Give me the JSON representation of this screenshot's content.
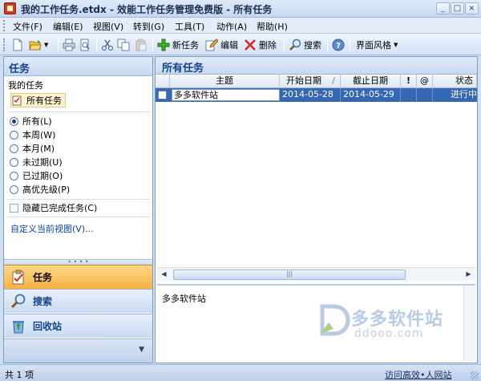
{
  "window": {
    "title": "我的工作任务.etdx - 效能工作任务管理免费版 - 所有任务",
    "buttons": {
      "minimize": "_",
      "maximize": "□",
      "close": "×"
    }
  },
  "menu": [
    "文件(F)",
    "编辑(E)",
    "视图(V)",
    "转到(G)",
    "工具(T)",
    "动作(A)",
    "帮助(H)"
  ],
  "toolbar": {
    "new_task": "新任务",
    "edit": "编辑",
    "delete": "删除",
    "search": "搜索",
    "theme": "界面风格"
  },
  "nav": {
    "header": "任务",
    "section_label": "我的任务",
    "current_view": "所有任务",
    "filters": [
      "所有(L)",
      "本周(W)",
      "本月(M)",
      "未过期(U)",
      "已过期(O)",
      "高优先级(P)"
    ],
    "selected_filter": "所有(L)",
    "hide_completed": "隐藏已完成任务(C)",
    "customize_link": "自定义当前视图(V)...",
    "buttons": [
      "任务",
      "搜索",
      "回收站"
    ],
    "active_button": "任务"
  },
  "main": {
    "header": "所有任务",
    "columns": [
      "主题",
      "开始日期",
      "/",
      "截止日期",
      "!",
      "@",
      "状态"
    ],
    "rows": [
      {
        "subject": "多多软件站",
        "start": "2014-05-28",
        "due": "2014-05-29",
        "status": "进行中"
      }
    ],
    "preview_text": "多多软件站"
  },
  "watermark": {
    "name": "多多软件站",
    "url": "ddooo.com"
  },
  "status": {
    "count": "共 1 项",
    "link": "访问高效•人网站"
  },
  "colors": {
    "accent": "#15428b",
    "selection": "#3467b4",
    "active_nav": "#f7b140"
  }
}
